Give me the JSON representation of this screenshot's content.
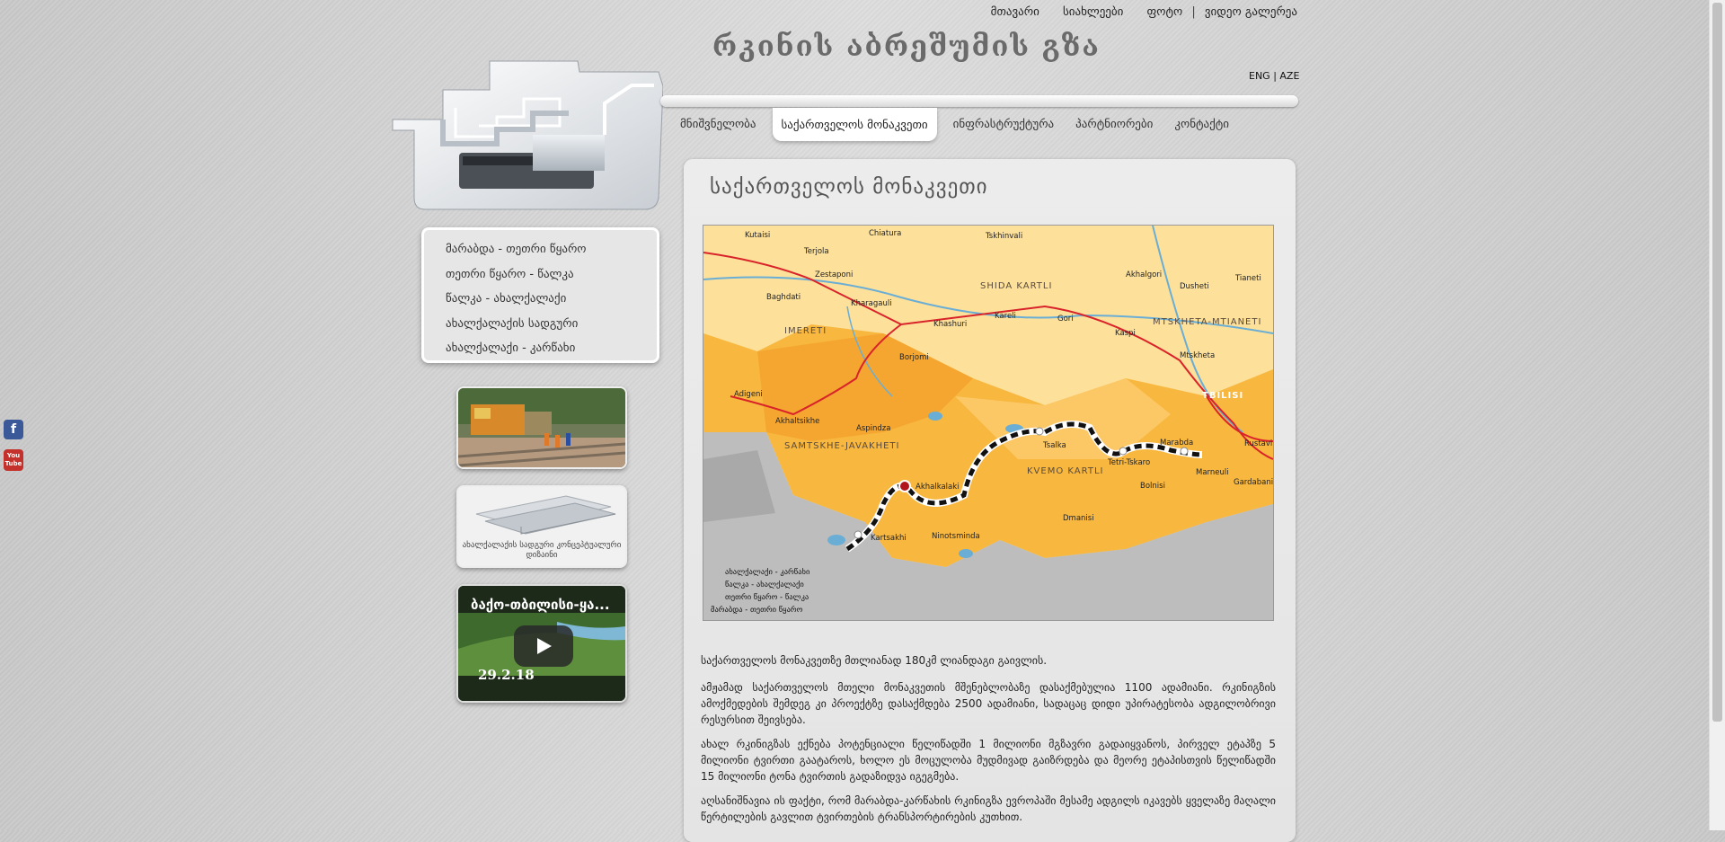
{
  "top_links": [
    "მთავარი",
    "სიახლეები",
    "ფოტო",
    "ვიდეო გალერეა"
  ],
  "site_title": "რკინის აბრეშუმის გზა",
  "languages": [
    "ENG",
    "AZE"
  ],
  "main_nav": {
    "items": [
      "მნიშვნელობა",
      "საქართველოს მონაკვეთი",
      "ინფრასტრუქტურა",
      "პარტნიორები",
      "კონტაქტი"
    ],
    "active_index": 1
  },
  "submenu": [
    "მარაბდა - თეთრი წყარო",
    "თეთრი წყარო - წალკა",
    "წალკა - ახალქალაქი",
    "ახალქალაქის სადგური",
    "ახალქალაქი - კარწახი"
  ],
  "thumb_caption": "ახალქალაქის სადგური კონცეპტუალური დიზაინი",
  "video": {
    "title": "ბაქო-თბილისი-ყა...",
    "date": "29.2.18"
  },
  "page_title": "საქართველოს მონაკვეთი",
  "map": {
    "regions": [
      "IMERETI",
      "SHIDA KARTLI",
      "MTSKHETA-MTIANETI",
      "SAMTSKHE-JAVAKHETI",
      "KVEMO KARTLI",
      "TBILISI"
    ],
    "towns": [
      "Kutaisi",
      "Chiatura",
      "Tskhinvali",
      "Terjola",
      "Zestaponi",
      "Baghdati",
      "Kharagauli",
      "Khashuri",
      "Kareli",
      "Gori",
      "Akhalgori",
      "Dusheti",
      "Tianeti",
      "Kaspi",
      "Mtskheta",
      "Borjomi",
      "Adigeni",
      "Akhaltsikhe",
      "Aspindza",
      "Tsalka",
      "Tetri-Tskaro",
      "Marabda",
      "Marneuli",
      "Rustavi",
      "Gardabani",
      "Bolnisi",
      "Akhalkalaki",
      "Dmanisi",
      "Kartsakhi",
      "Ninotsminda"
    ],
    "legend": [
      "ახალქალაქი - კარწახი",
      "წალკა - ახალქალაქი",
      "თეთრი წყარო - წალკა",
      "მარაბდა - თეთრი წყარო"
    ]
  },
  "paragraphs": [
    "საქართველოს მონაკვეთზე მთლიანად 180კმ ლიანდაგი გაივლის.",
    "ამჟამად საქართველოს მთელი მონაკვეთის მშენებლობაზე დასაქმებულია 1100 ადამიანი. რკინიგზის ამოქმედების შემდეგ კი პროექტზე დასაქმდება 2500 ადამიანი, სადაცაც დიდი უპირატესობა ადგილობრივი რესურსით შეივსება.",
    "ახალ რკინიგზას ექნება პოტენციალი წელიწადში 1 მილიონი მგზავრი გადაიყვანოს, პირველ ეტაპზე 5 მილიონი ტვირთი გაატაროს, ხოლო ეს მოცულობა მუდმივად გაიზრდება და მეორე ეტაპისთვის წელიწადში 15 მილიონი ტონა ტვირთის გადაზიდვა იგეგმება.",
    "აღსანიშნავია ის ფაქტი, რომ მარაბდა-კარწახის რკინიგზა ევროპაში მესამე ადგილს იკავებს ყველაზე მაღალი წერტილების გავლით ტვირთების ტრანსპორტირების კუთხით."
  ],
  "colors": {
    "accent": "#6a6a6a",
    "map_orange": "#f7b13d",
    "map_light": "#fdd680",
    "route": "#111111"
  }
}
